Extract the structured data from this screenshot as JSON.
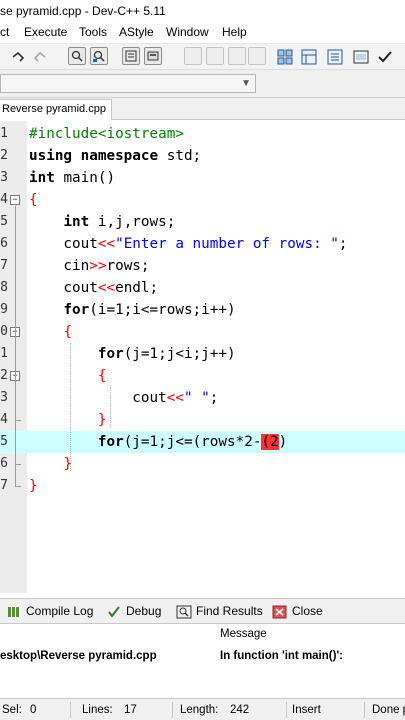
{
  "window": {
    "title": "se pyramid.cpp - Dev-C++ 5.11"
  },
  "menu": {
    "items": [
      "ct",
      "Execute",
      "Tools",
      "AStyle",
      "Window",
      "Help"
    ]
  },
  "toolbar": {
    "icons": [
      "undo-icon",
      "redo-icon",
      "find-icon",
      "replace-icon",
      "goto-icon",
      "compile-icon",
      "new-project-icon",
      "open-project-icon",
      "save-project-icon",
      "close-project-icon",
      "grid-icon",
      "class-icon",
      "check-icon"
    ]
  },
  "file_tab": {
    "label": "Reverse pyramid.cpp"
  },
  "editor": {
    "gutter_numbers": [
      "1",
      "2",
      "3",
      "4",
      "5",
      "6",
      "7",
      "8",
      "9",
      "0",
      "1",
      "2",
      "3",
      "4",
      "5",
      "6",
      "7"
    ],
    "lines": [
      {
        "parts": [
          [
            "pp",
            "#include<iostream>"
          ]
        ]
      },
      {
        "parts": [
          [
            "k",
            "using namespace "
          ],
          [
            "",
            "std;"
          ]
        ]
      },
      {
        "parts": [
          [
            "k",
            "int "
          ],
          [
            "",
            "main()"
          ]
        ]
      },
      {
        "parts": [
          [
            "op",
            "{"
          ]
        ]
      },
      {
        "parts": [
          [
            "",
            "    "
          ],
          [
            "k",
            "int "
          ],
          [
            "",
            "i,j,rows;"
          ]
        ]
      },
      {
        "parts": [
          [
            "",
            "    cout"
          ],
          [
            "op",
            "<<"
          ],
          [
            "st",
            "\"Enter a number of rows: \""
          ],
          [
            "",
            ";"
          ]
        ]
      },
      {
        "parts": [
          [
            "",
            "    cin"
          ],
          [
            "op",
            ">>"
          ],
          [
            "",
            "rows;"
          ]
        ]
      },
      {
        "parts": [
          [
            "",
            "    cout"
          ],
          [
            "op",
            "<<"
          ],
          [
            "",
            "endl;"
          ]
        ]
      },
      {
        "parts": [
          [
            "",
            "    "
          ],
          [
            "k",
            "for"
          ],
          [
            "",
            "(i=1;i<=rows;i++)"
          ]
        ]
      },
      {
        "parts": [
          [
            "",
            "    "
          ],
          [
            "op",
            "{"
          ]
        ]
      },
      {
        "parts": [
          [
            "",
            "        "
          ],
          [
            "k",
            "for"
          ],
          [
            "",
            "(j=1;j<i;j++)"
          ]
        ]
      },
      {
        "parts": [
          [
            "",
            "        "
          ],
          [
            "op",
            "{"
          ]
        ]
      },
      {
        "parts": [
          [
            "",
            "            cout"
          ],
          [
            "op",
            "<<"
          ],
          [
            "st",
            "\" \""
          ],
          [
            "",
            ";"
          ]
        ]
      },
      {
        "parts": [
          [
            "",
            "        "
          ],
          [
            "op",
            "}"
          ]
        ]
      },
      {
        "parts": [
          [
            "",
            "        "
          ],
          [
            "k",
            "for"
          ],
          [
            "",
            "(j=1;j<=(rows*2-"
          ],
          [
            "brk",
            "(2"
          ],
          [
            "",
            ")"
          ]
        ]
      },
      {
        "parts": [
          [
            "",
            "    "
          ],
          [
            "op",
            "}"
          ]
        ]
      },
      {
        "parts": [
          [
            "op",
            "}"
          ]
        ]
      }
    ]
  },
  "bottom_tabs": {
    "compile_log": "Compile Log",
    "debug": "Debug",
    "find_results": "Find Results",
    "close": "Close"
  },
  "messages": {
    "header": "Message",
    "file": "esktop\\Reverse pyramid.cpp",
    "message": "In function 'int main()':"
  },
  "status": {
    "sel_label": "Sel:",
    "sel_value": "0",
    "lines_label": "Lines:",
    "lines_value": "17",
    "length_label": "Length:",
    "length_value": "242",
    "mode": "Insert",
    "state": "Done p"
  },
  "colors": {
    "current_line": "#ccffff",
    "bracket_match": "#ff3333",
    "preprocessor": "#008000",
    "string": "#0000ff",
    "operator": "#ff0000"
  }
}
